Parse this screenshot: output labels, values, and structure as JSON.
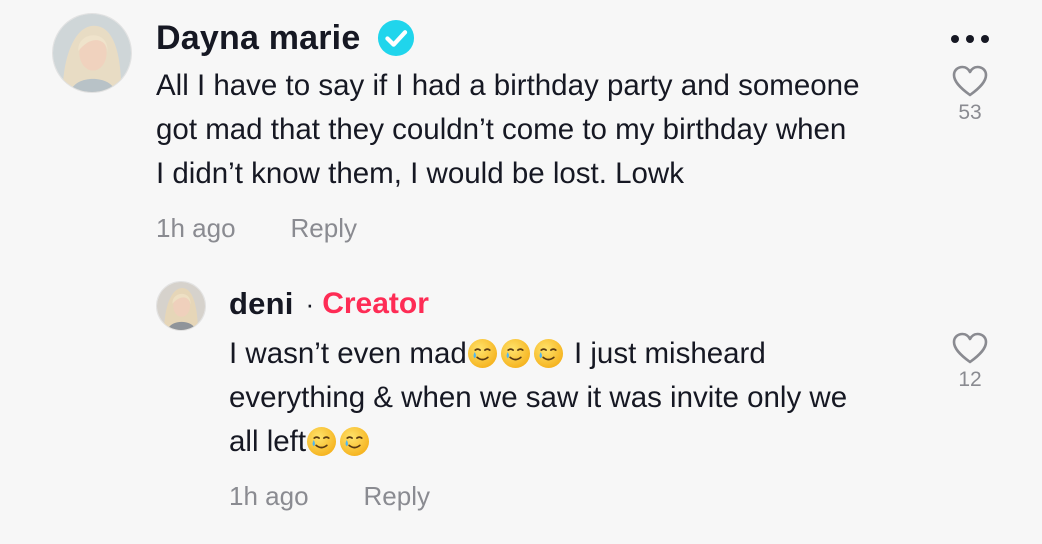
{
  "comment": {
    "username": "Dayna marie",
    "verified": true,
    "text_lines": [
      "All I have to say if I had a birthday party and someone",
      "got mad that they couldn’t come to my birthday when",
      "I didn’t know them, I would be lost. Lowk"
    ],
    "timestamp": "1h ago",
    "reply_label": "Reply",
    "like_count": "53",
    "icons": {
      "more": "more-dots-icon",
      "like": "heart-outline-icon",
      "verified": "verified-check-icon"
    }
  },
  "reply": {
    "username": "deni",
    "separator": "·",
    "badge": "Creator",
    "line1_text": "I wasn’t even mad",
    "line1_emoji": [
      "🥲",
      "🥲",
      "🥲"
    ],
    "line1_suffix": " I just misheard",
    "line2": "everything & when we saw it was invite only we",
    "line3_text": "all left",
    "line3_emoji": [
      "🥲",
      "🥲"
    ],
    "timestamp": "1h ago",
    "reply_label": "Reply",
    "like_count": "12",
    "icons": {
      "like": "heart-outline-icon",
      "emoji": "smiling-face-with-tear-emoji"
    }
  },
  "colors": {
    "background": "#f7f7f7",
    "text": "#161823",
    "secondary": "#8a8b91",
    "creator": "#fe2c55",
    "verified": "#20d5ec"
  }
}
